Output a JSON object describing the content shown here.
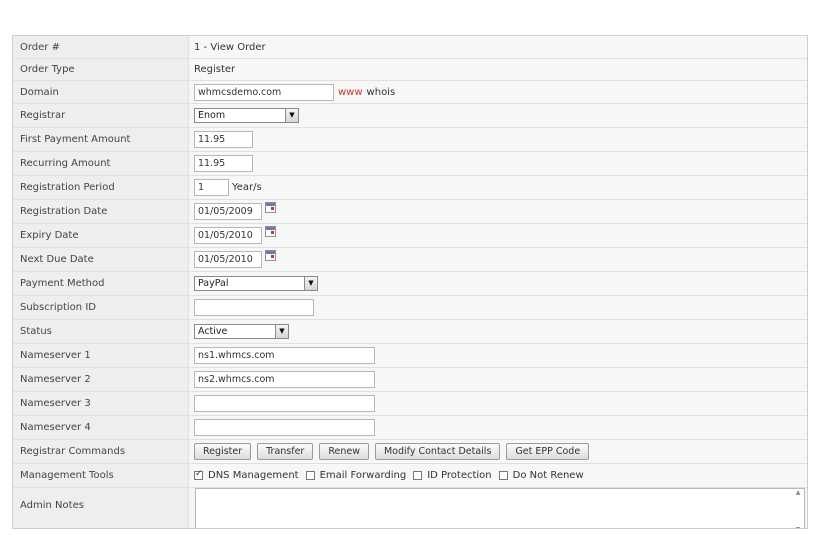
{
  "order": {
    "label": "Order #",
    "value": "1 - View Order"
  },
  "order_type": {
    "label": "Order Type",
    "value": "Register"
  },
  "domain": {
    "label": "Domain",
    "value": "whmcsdemo.com",
    "www_link": "www",
    "whois_link": "whois"
  },
  "registrar": {
    "label": "Registrar",
    "value": "Enom"
  },
  "first_payment": {
    "label": "First Payment Amount",
    "value": "11.95"
  },
  "recurring": {
    "label": "Recurring Amount",
    "value": "11.95"
  },
  "reg_period": {
    "label": "Registration Period",
    "value": "1",
    "unit": "Year/s"
  },
  "reg_date": {
    "label": "Registration Date",
    "value": "01/05/2009"
  },
  "expiry_date": {
    "label": "Expiry Date",
    "value": "01/05/2010"
  },
  "next_due": {
    "label": "Next Due Date",
    "value": "01/05/2010"
  },
  "payment_method": {
    "label": "Payment Method",
    "value": "PayPal"
  },
  "subscription": {
    "label": "Subscription ID",
    "value": ""
  },
  "status": {
    "label": "Status",
    "value": "Active"
  },
  "ns1": {
    "label": "Nameserver 1",
    "value": "ns1.whmcs.com"
  },
  "ns2": {
    "label": "Nameserver 2",
    "value": "ns2.whmcs.com"
  },
  "ns3": {
    "label": "Nameserver 3",
    "value": ""
  },
  "ns4": {
    "label": "Nameserver 4",
    "value": ""
  },
  "registrar_commands": {
    "label": "Registrar Commands",
    "buttons": [
      "Register",
      "Transfer",
      "Renew",
      "Modify Contact Details",
      "Get EPP Code"
    ]
  },
  "management_tools": {
    "label": "Management Tools",
    "options": [
      {
        "label": "DNS Management",
        "checked": true
      },
      {
        "label": "Email Forwarding",
        "checked": false
      },
      {
        "label": "ID Protection",
        "checked": false
      },
      {
        "label": "Do Not Renew",
        "checked": false
      }
    ]
  },
  "admin_notes": {
    "label": "Admin Notes",
    "value": ""
  },
  "colors": {
    "link_red": "#c0392b",
    "label_bg": "#eeeeee",
    "border": "#cfcfcf"
  }
}
